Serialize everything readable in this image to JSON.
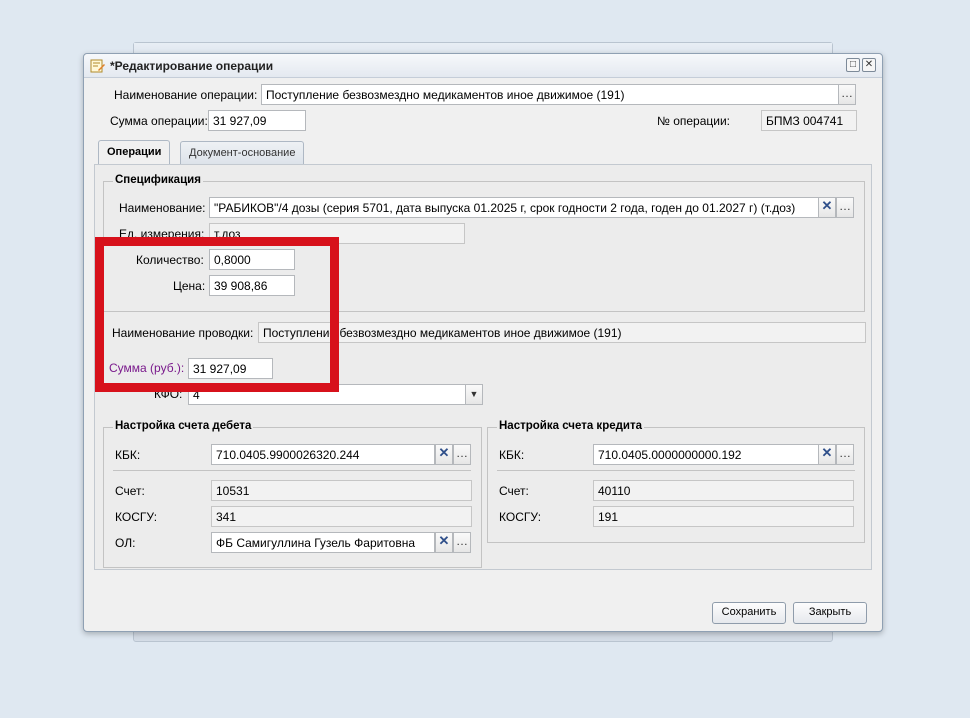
{
  "dialog": {
    "title": "*Редактирование операции",
    "op_name_label": "Наименование операции:",
    "op_name_value": "Поступление безвозмездно медикаментов иное движимое (191)",
    "op_sum_label": "Сумма операции:",
    "op_sum_value": "31 927,09",
    "op_number_label": "№ операции:",
    "op_number_value": "БПМЗ 004741"
  },
  "tabs": [
    {
      "label": "Операции",
      "active": true
    },
    {
      "label": "Документ-основание",
      "active": false
    }
  ],
  "spec": {
    "title": "Спецификация",
    "name_label": "Наименование:",
    "name_value": "\"РАБИКОВ\"/4 дозы (серия 5701, дата выпуска 01.2025 г, срок годности 2 года, годен до 01.2027 г) (т.доз)",
    "unit_label": "Ед. измерения:",
    "unit_value": "т.доз",
    "qty_label": "Количество:",
    "qty_value": "0,8000",
    "price_label": "Цена:",
    "price_value": "39 908,86"
  },
  "posting": {
    "name_label": "Наименование проводки:",
    "name_value": "Поступление безвозмездно медикаментов иное движимое (191)",
    "sum_label": "Сумма (руб.):",
    "sum_value": "31 927,09",
    "kfo_label": "КФО:",
    "kfo_value": "4"
  },
  "debit": {
    "title": "Настройка счета дебета",
    "kbk_label": "КБК:",
    "kbk_value": "710.0405.9900026320.244",
    "account_label": "Счет:",
    "account_value": "10531",
    "kosgu_label": "КОСГУ:",
    "kosgu_value": "341",
    "ol_label": "ОЛ:",
    "ol_value": "ФБ Самигуллина Гузель Фаритовна"
  },
  "credit": {
    "title": "Настройка счета кредита",
    "kbk_label": "КБК:",
    "kbk_value": "710.0405.0000000000.192",
    "account_label": "Счет:",
    "account_value": "40110",
    "kosgu_label": "КОСГУ:",
    "kosgu_value": "191"
  },
  "buttons": {
    "save": "Сохранить",
    "close": "Закрыть",
    "ellipsis": "…",
    "clear": "✕",
    "dropdown": "▼",
    "maximize": "□",
    "close_x": "✕"
  },
  "colors": {
    "highlight": "#d7111b",
    "sum_label": "#7a1a8c"
  }
}
